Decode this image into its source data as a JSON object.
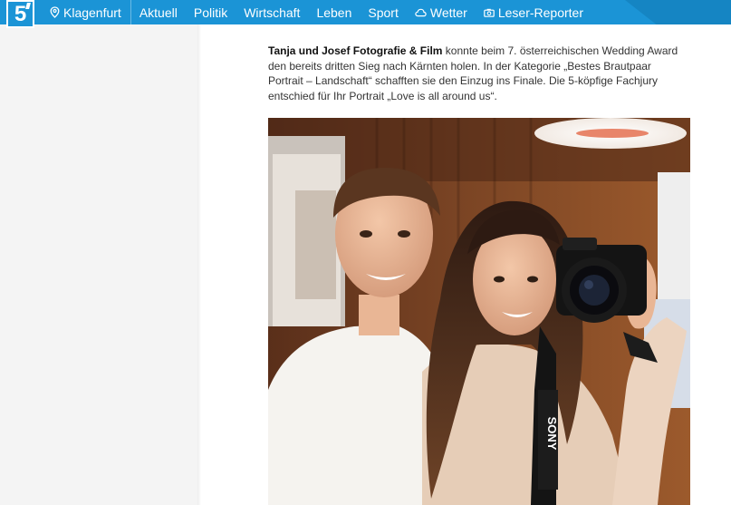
{
  "brand": {
    "logo_text": "5"
  },
  "nav": {
    "location": "Klagenfurt",
    "items": [
      "Aktuell",
      "Politik",
      "Wirtschaft",
      "Leben",
      "Sport"
    ],
    "weather": "Wetter",
    "reporter": "Leser-Reporter"
  },
  "article": {
    "lead_bold": "Tanja und Josef Fotografie & Film",
    "lead_rest": " konnte beim 7. österreichischen Wedding Award den bereits dritten Sieg nach Kärnten holen. In der Kategorie „Bestes Brautpaar Portrait – Landschaft“ schafften sie den Einzug ins Finale. Die 5-köpfige Fachjury entschied für Ihr Portrait „Love is all around us“."
  },
  "image": {
    "camera_strap_brand": "SONY"
  },
  "colors": {
    "nav_bg": "#1b94d6",
    "nav_stripe": "#1585c3",
    "sidebar_bg": "#f4f4f4"
  }
}
